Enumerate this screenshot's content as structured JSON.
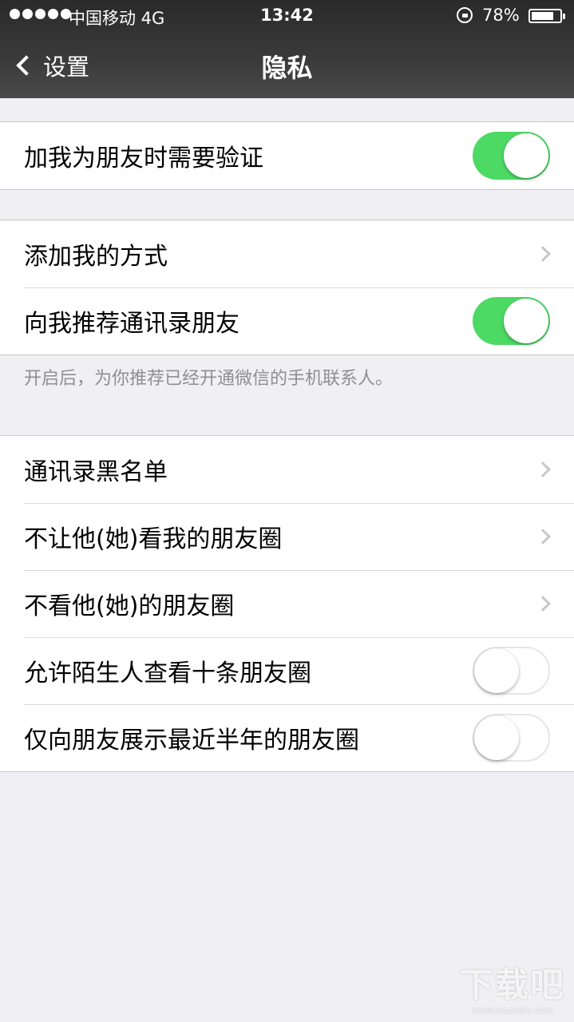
{
  "status_bar": {
    "carrier": "中国移动  4G",
    "time": "13:42",
    "battery": "78%",
    "battery_level": 0.78
  },
  "nav": {
    "back_label": "设置",
    "title": "隐私"
  },
  "sections": {
    "verify": {
      "label": "加我为朋友时需要验证",
      "toggle": true
    },
    "add_methods": {
      "label": "添加我的方式"
    },
    "recommend_contacts": {
      "label": "向我推荐通讯录朋友",
      "toggle": true,
      "footnote": "开启后，为你推荐已经开通微信的手机联系人。"
    },
    "blacklist": {
      "label": "通讯录黑名单"
    },
    "hide_moments_from": {
      "label": "不让他(她)看我的朋友圈"
    },
    "dont_see_moments": {
      "label": "不看他(她)的朋友圈"
    },
    "stranger_ten_posts": {
      "label": "允许陌生人查看十条朋友圈",
      "toggle": false
    },
    "half_year_moments": {
      "label": "仅向朋友展示最近半年的朋友圈",
      "toggle": false
    }
  },
  "colors": {
    "toggle_on": "#4cd964",
    "background": "#efeff4",
    "nav_bar": "#3a3a3b"
  },
  "watermark": {
    "main": "下载吧",
    "sub": "www.xiazaiba.com"
  }
}
